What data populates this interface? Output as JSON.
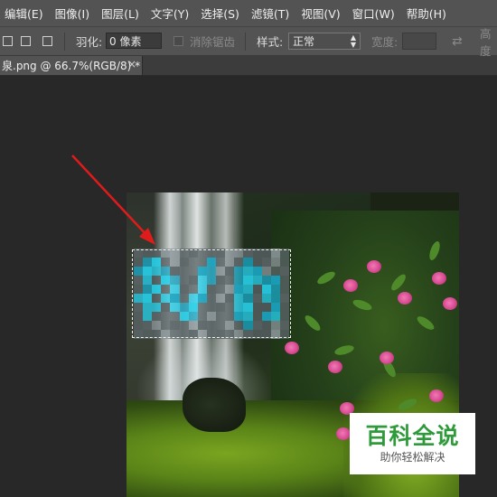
{
  "menubar": {
    "items": [
      "编辑(E)",
      "图像(I)",
      "图层(L)",
      "文字(Y)",
      "选择(S)",
      "滤镜(T)",
      "视图(V)",
      "窗口(W)",
      "帮助(H)"
    ]
  },
  "options": {
    "feather_label": "羽化:",
    "feather_value": "0 像素",
    "antialias_label": "消除锯齿",
    "style_label": "样式:",
    "style_value": "正常",
    "width_label": "宽度:",
    "height_label": "高度"
  },
  "document": {
    "tab_title": "泉.png @ 66.7%(RGB/8) *",
    "close_glyph": "×"
  },
  "annotation": {
    "arrow_color": "#e01b1b"
  },
  "watermark": {
    "title": "百科全说",
    "subtitle": "助你轻松解决"
  },
  "colors": {
    "ui_panel": "#535353",
    "workspace": "#282828",
    "watermark_green": "#2e9a3a"
  }
}
